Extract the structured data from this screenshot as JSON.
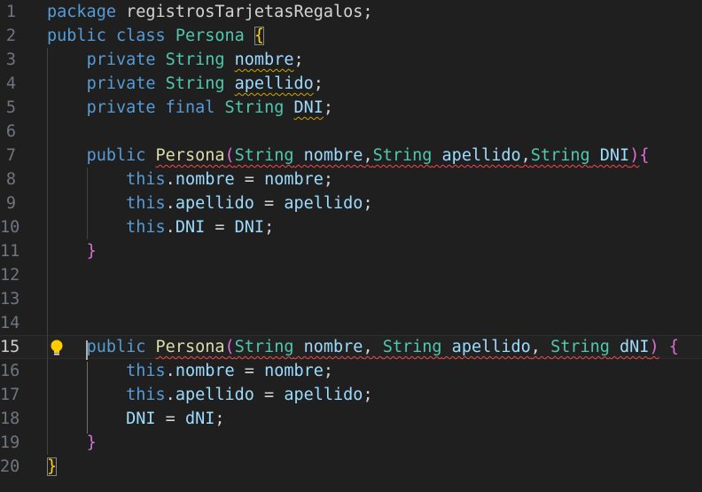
{
  "editor": {
    "language": "java",
    "current_line": 15,
    "lines": [
      {
        "n": "1",
        "t": [
          [
            "kw",
            "package"
          ],
          [
            "pn",
            " registrosTarjetasRegalos;"
          ]
        ]
      },
      {
        "n": "2",
        "t": [
          [
            "kw",
            "public"
          ],
          [
            "pn",
            " "
          ],
          [
            "kw",
            "class"
          ],
          [
            "pn",
            " "
          ],
          [
            "ty",
            "Persona"
          ],
          [
            "pn",
            " "
          ],
          [
            "b1 box",
            "{"
          ]
        ]
      },
      {
        "n": "3",
        "t": [
          [
            "pn",
            "    "
          ],
          [
            "kw",
            "private"
          ],
          [
            "pn",
            " "
          ],
          [
            "ty",
            "String"
          ],
          [
            "pn",
            " "
          ],
          [
            "var warn",
            "nombre"
          ],
          [
            "pn",
            ";"
          ]
        ]
      },
      {
        "n": "4",
        "t": [
          [
            "pn",
            "    "
          ],
          [
            "kw",
            "private"
          ],
          [
            "pn",
            " "
          ],
          [
            "ty",
            "String"
          ],
          [
            "pn",
            " "
          ],
          [
            "var warn",
            "apellido"
          ],
          [
            "pn",
            ";"
          ]
        ]
      },
      {
        "n": "5",
        "t": [
          [
            "pn",
            "    "
          ],
          [
            "kw",
            "private"
          ],
          [
            "pn",
            " "
          ],
          [
            "kw",
            "final"
          ],
          [
            "pn",
            " "
          ],
          [
            "ty",
            "String"
          ],
          [
            "pn",
            " "
          ],
          [
            "var warn",
            "DNI"
          ],
          [
            "pn",
            ";"
          ]
        ]
      },
      {
        "n": "6",
        "t": []
      },
      {
        "n": "7",
        "t": [
          [
            "pn",
            "    "
          ],
          [
            "kw",
            "public"
          ],
          [
            "pn",
            " "
          ],
          [
            "fn err",
            "Persona"
          ],
          [
            "b2 err",
            "("
          ],
          [
            "ty err",
            "String"
          ],
          [
            "var err",
            " nombre"
          ],
          [
            "pn err",
            ","
          ],
          [
            "ty err",
            "String"
          ],
          [
            "var err",
            " apellido"
          ],
          [
            "pn err",
            ","
          ],
          [
            "ty err",
            "String"
          ],
          [
            "var err",
            " DNI"
          ],
          [
            "b2 err",
            ")"
          ],
          [
            "b2",
            "{"
          ]
        ]
      },
      {
        "n": "8",
        "t": [
          [
            "pn",
            "        "
          ],
          [
            "kw",
            "this"
          ],
          [
            "pn",
            "."
          ],
          [
            "var",
            "nombre"
          ],
          [
            "pn",
            " = "
          ],
          [
            "var",
            "nombre"
          ],
          [
            "pn",
            ";"
          ]
        ]
      },
      {
        "n": "9",
        "t": [
          [
            "pn",
            "        "
          ],
          [
            "kw",
            "this"
          ],
          [
            "pn",
            "."
          ],
          [
            "var",
            "apellido"
          ],
          [
            "pn",
            " = "
          ],
          [
            "var",
            "apellido"
          ],
          [
            "pn",
            ";"
          ]
        ]
      },
      {
        "n": "10",
        "t": [
          [
            "pn",
            "        "
          ],
          [
            "kw",
            "this"
          ],
          [
            "pn",
            "."
          ],
          [
            "var",
            "DNI"
          ],
          [
            "pn",
            " = "
          ],
          [
            "var",
            "DNI"
          ],
          [
            "pn",
            ";"
          ]
        ]
      },
      {
        "n": "11",
        "t": [
          [
            "pn",
            "    "
          ],
          [
            "b2",
            "}"
          ]
        ]
      },
      {
        "n": "12",
        "t": []
      },
      {
        "n": "13",
        "t": []
      },
      {
        "n": "14",
        "t": []
      },
      {
        "n": "15",
        "t": [
          [
            "pn",
            "    "
          ],
          [
            "kw",
            "public"
          ],
          [
            "pn",
            " "
          ],
          [
            "fn err",
            "Persona"
          ],
          [
            "b2 err",
            "("
          ],
          [
            "ty err",
            "String"
          ],
          [
            "var err",
            " nombre"
          ],
          [
            "pn err",
            ", "
          ],
          [
            "ty err",
            "String"
          ],
          [
            "var err",
            " apellido"
          ],
          [
            "pn err",
            ", "
          ],
          [
            "ty err",
            "String"
          ],
          [
            "var err",
            " dNI"
          ],
          [
            "b2 err",
            ")"
          ],
          [
            "pn",
            " "
          ],
          [
            "b2",
            "{"
          ]
        ]
      },
      {
        "n": "16",
        "t": [
          [
            "pn",
            "        "
          ],
          [
            "kw",
            "this"
          ],
          [
            "pn",
            "."
          ],
          [
            "var",
            "nombre"
          ],
          [
            "pn",
            " = "
          ],
          [
            "var",
            "nombre"
          ],
          [
            "pn",
            ";"
          ]
        ]
      },
      {
        "n": "17",
        "t": [
          [
            "pn",
            "        "
          ],
          [
            "kw",
            "this"
          ],
          [
            "pn",
            "."
          ],
          [
            "var",
            "apellido"
          ],
          [
            "pn",
            " = "
          ],
          [
            "var",
            "apellido"
          ],
          [
            "pn",
            ";"
          ]
        ]
      },
      {
        "n": "18",
        "t": [
          [
            "pn",
            "        "
          ],
          [
            "var",
            "DNI"
          ],
          [
            "pn",
            " = "
          ],
          [
            "var",
            "dNI"
          ],
          [
            "pn",
            ";"
          ]
        ]
      },
      {
        "n": "19",
        "t": [
          [
            "pn",
            "    "
          ],
          [
            "b2",
            "}"
          ]
        ]
      },
      {
        "n": "20",
        "t": [
          [
            "b1 box",
            "}"
          ]
        ]
      }
    ]
  },
  "icons": {
    "lightbulb": "lightbulb-icon"
  },
  "colors": {
    "background": "#1f1f1f",
    "keyword": "#569cd6",
    "type": "#4ec9b0",
    "function": "#dcdcaa",
    "variable": "#9cdcfe",
    "bracket_level1": "#ffd700",
    "bracket_level2": "#da70d6",
    "error_squiggle": "#f14c4c",
    "warning_squiggle": "#cca700"
  }
}
